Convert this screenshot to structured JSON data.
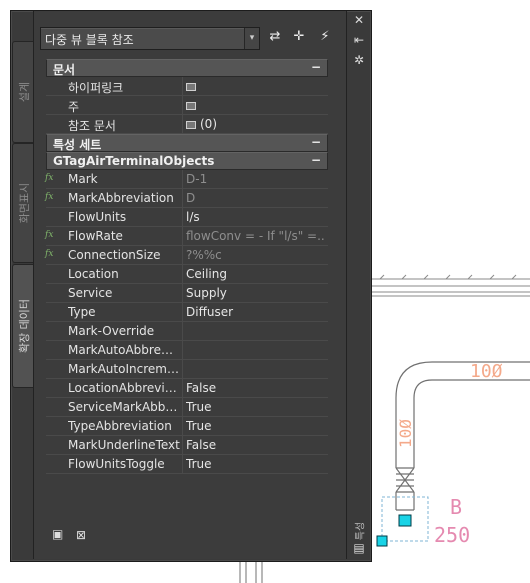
{
  "palette": {
    "tabs": [
      {
        "label": "설계",
        "active": false
      },
      {
        "label": "화면표시",
        "active": false
      },
      {
        "label": "확장 데이터",
        "active": true
      }
    ],
    "combo_value": "다중 뷰 블록 참조",
    "right_strip_label": "특성"
  },
  "categories": [
    {
      "label": "문서",
      "toggle": "−",
      "rows": [
        {
          "name": "하이퍼링크",
          "value": "",
          "icon": "table-icon",
          "fx": false,
          "gray": false
        },
        {
          "name": "주",
          "value": "",
          "icon": "table-icon",
          "fx": false,
          "gray": false
        },
        {
          "name": "참조 문서",
          "value": "(0)",
          "icon": "table-icon",
          "fx": false,
          "gray": false
        }
      ]
    },
    {
      "label": "특성 세트",
      "toggle": "−",
      "rows": []
    },
    {
      "label": "GTagAirTerminalObjects",
      "toggle": "−",
      "rows": [
        {
          "name": "Mark",
          "value": "D-1",
          "fx": true,
          "gray": true
        },
        {
          "name": "MarkAbbreviation",
          "value": "D",
          "fx": true,
          "gray": true
        },
        {
          "name": "FlowUnits",
          "value": "l/s",
          "fx": false,
          "gray": false
        },
        {
          "name": "FlowRate",
          "value": "flowConv = - If \"l/s\" =...",
          "fx": true,
          "gray": true
        },
        {
          "name": "ConnectionSize",
          "value": "?%%c",
          "fx": true,
          "gray": true
        },
        {
          "name": "Location",
          "value": "Ceiling",
          "fx": false,
          "gray": false
        },
        {
          "name": "Service",
          "value": "Supply",
          "fx": false,
          "gray": false
        },
        {
          "name": "Type",
          "value": "Diffuser",
          "fx": false,
          "gray": false
        },
        {
          "name": "Mark-Override",
          "value": "",
          "fx": false,
          "gray": false
        },
        {
          "name": "MarkAutoAbbreviation",
          "value": "",
          "fx": false,
          "gray": false
        },
        {
          "name": "MarkAutoIncrement",
          "value": "",
          "fx": false,
          "gray": false
        },
        {
          "name": "LocationAbbreviation",
          "value": "False",
          "fx": false,
          "gray": false
        },
        {
          "name": "ServiceMarkAbbreviation",
          "value": "True",
          "fx": false,
          "gray": false
        },
        {
          "name": "TypeAbbreviation",
          "value": "True",
          "fx": false,
          "gray": false
        },
        {
          "name": "MarkUnderlineText",
          "value": "False",
          "fx": false,
          "gray": false
        },
        {
          "name": "FlowUnitsToggle",
          "value": "True",
          "fx": false,
          "gray": false
        }
      ]
    }
  ],
  "cad": {
    "duct_size_horizontal": "10Ø",
    "duct_size_vertical": "10Ø",
    "tag_letter": "B",
    "tag_value": "250",
    "colors": {
      "duct_text": "#f4a98a",
      "tag": "#e58ab0",
      "grip": "#19d3e6",
      "line": "#6f6f6f"
    }
  }
}
